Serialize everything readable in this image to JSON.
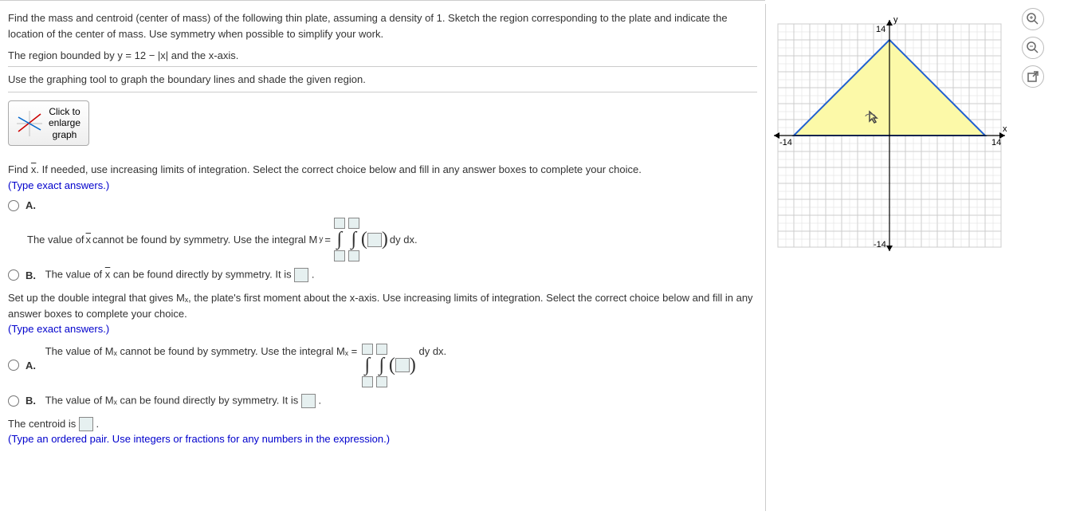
{
  "intro": "Find the mass and centroid (center of mass) of the following thin plate, assuming a density of 1. Sketch the region corresponding to the plate and indicate the location of the center of mass. Use symmetry when possible to simplify your work.",
  "region": "The region bounded by y = 12 − |x| and the x-axis.",
  "graph_instr": "Use the graphing tool to graph the boundary lines and shade the given region.",
  "graph_btn": {
    "l1": "Click to",
    "l2": "enlarge",
    "l3": "graph"
  },
  "q1": {
    "prompt_a": "Find ",
    "prompt_b": ". If needed, use increasing limits of integration. Select the correct choice below and fill in any answer boxes to complete your choice.",
    "hint": "(Type exact answers.)",
    "optA": {
      "label": "A.",
      "pre": "The value of ",
      "mid": " cannot be found by symmetry. Use the integral M",
      "sub": "y",
      "post": " = ",
      "tail": " dy dx."
    },
    "optB": {
      "label": "B.",
      "pre": "The value of ",
      "mid": " can be found directly by symmetry. It is "
    }
  },
  "q2": {
    "prompt": "Set up the double integral that gives Mₓ, the plate's first moment about the x-axis. Use increasing limits of integration. Select the correct choice below and fill in any answer boxes to complete your choice.",
    "hint": "(Type exact answers.)",
    "optA": {
      "label": "A.",
      "text": "The value of Mₓ cannot be found by symmetry. Use the integral Mₓ = ",
      "tail": " dy dx."
    },
    "optB": {
      "label": "B.",
      "text": "The value of Mₓ can be found directly by symmetry. It is "
    }
  },
  "centroid": {
    "text": "The centroid is ",
    "hint": "(Type an ordered pair. Use integers or fractions for any numbers in the expression.)"
  },
  "graph": {
    "xlabel": "x",
    "ylabel": "y",
    "yhi": "14",
    "ylo": "-14",
    "xlo": "-14",
    "xhi": "14"
  },
  "chart_data": {
    "type": "area",
    "title": "Region bounded by y = 12 − |x| and the x-axis",
    "x_range": [
      -14,
      14
    ],
    "y_range": [
      -14,
      14
    ],
    "vertices": [
      [
        -12,
        0
      ],
      [
        0,
        12
      ],
      [
        12,
        0
      ]
    ],
    "xlabel": "x",
    "ylabel": "y"
  }
}
